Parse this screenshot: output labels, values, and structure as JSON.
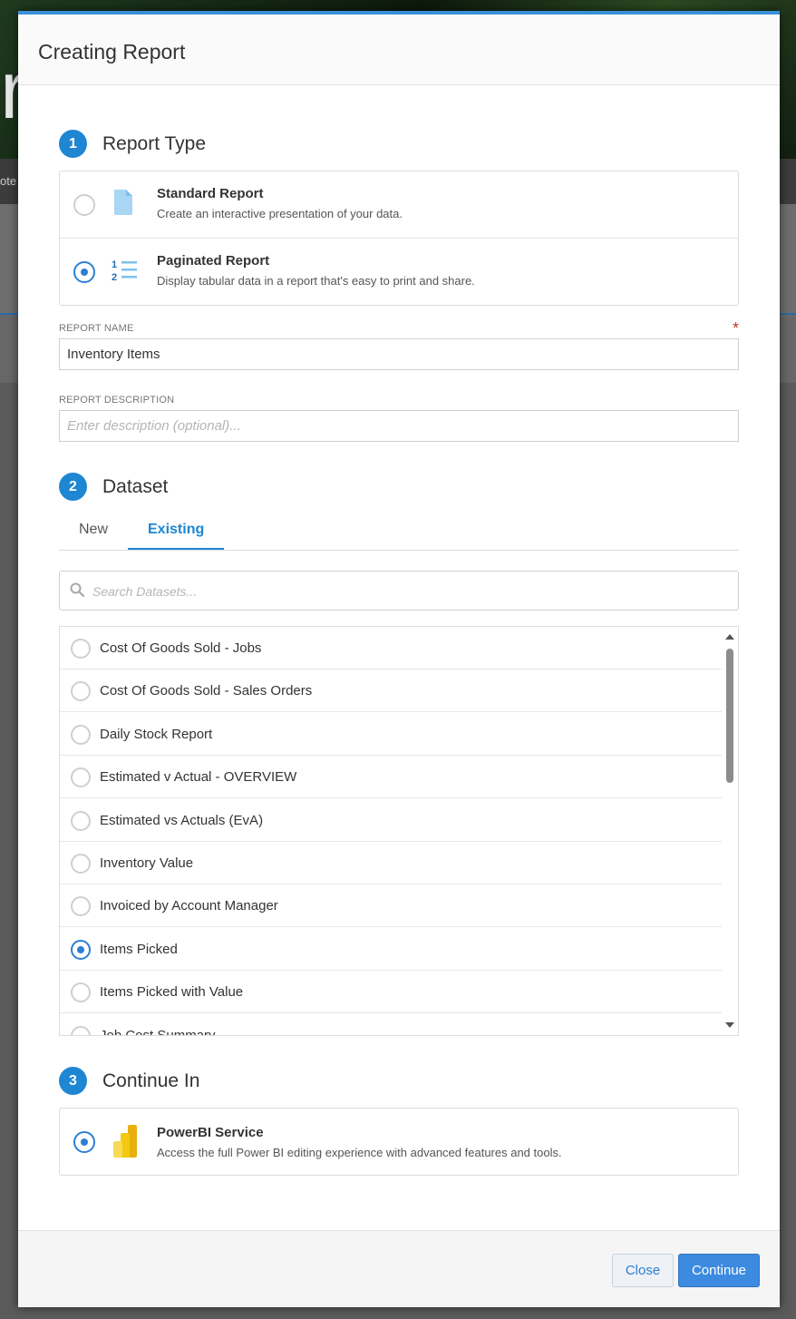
{
  "backdrop": {
    "nav_text": "ote"
  },
  "modal": {
    "title": "Creating Report"
  },
  "steps": {
    "report_type": {
      "num": "1",
      "label": "Report Type"
    },
    "dataset": {
      "num": "2",
      "label": "Dataset"
    },
    "continue_in": {
      "num": "3",
      "label": "Continue In"
    }
  },
  "report_types": {
    "standard": {
      "title": "Standard Report",
      "desc": "Create an interactive presentation of your data.",
      "selected": false,
      "icon": "document-icon"
    },
    "paginated": {
      "title": "Paginated Report",
      "desc": "Display tabular data in a report that's easy to print and share.",
      "selected": true,
      "icon": "numbered-list-icon"
    }
  },
  "report_name": {
    "label": "REPORT NAME",
    "required_mark": "*",
    "value": "Inventory Items"
  },
  "report_description": {
    "label": "REPORT DESCRIPTION",
    "placeholder": "Enter description (optional)..."
  },
  "dataset_tabs": {
    "new": "New",
    "existing": "Existing",
    "active": "Existing"
  },
  "dataset_search": {
    "placeholder": "Search Datasets..."
  },
  "datasets": [
    {
      "label": "Cost Of Goods Sold - Jobs",
      "selected": false
    },
    {
      "label": "Cost Of Goods Sold - Sales Orders",
      "selected": false
    },
    {
      "label": "Daily Stock Report",
      "selected": false
    },
    {
      "label": "Estimated v Actual - OVERVIEW",
      "selected": false
    },
    {
      "label": "Estimated vs Actuals (EvA)",
      "selected": false
    },
    {
      "label": "Inventory Value",
      "selected": false
    },
    {
      "label": "Invoiced by Account Manager",
      "selected": false
    },
    {
      "label": "Items Picked",
      "selected": true
    },
    {
      "label": "Items Picked with Value",
      "selected": false
    },
    {
      "label": "Job Cost Summary",
      "selected": false
    }
  ],
  "continue_in": {
    "title": "PowerBI Service",
    "desc": "Access the full Power BI editing experience with advanced features and tools.",
    "selected": true,
    "icon": "powerbi-icon"
  },
  "footer": {
    "close_label": "Close",
    "continue_label": "Continue"
  },
  "colors": {
    "accent": "#1e86d3",
    "button_primary": "#3d8be0",
    "required": "#c0392b",
    "powerbi_yellow": "#f2c811"
  }
}
